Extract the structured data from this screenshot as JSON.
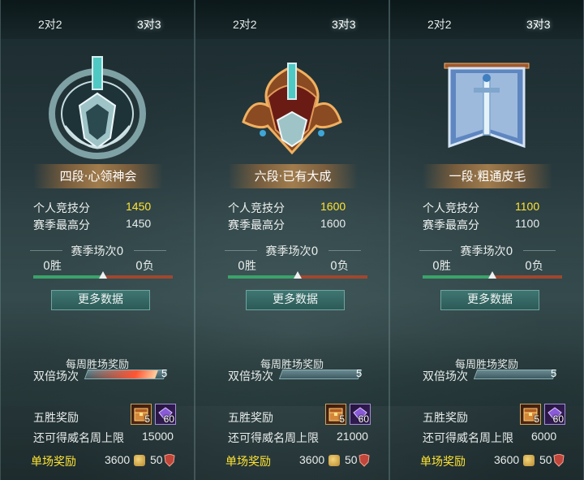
{
  "panels": [
    {
      "tabs": [
        "2对2",
        "3对3"
      ],
      "rank_name": "四段·心领神会",
      "personal_score_label": "个人竞技分",
      "personal_score": "1450",
      "season_high_label": "赛季最高分",
      "season_high": "1450",
      "season_matches_label": "赛季场次0",
      "wins": "0胜",
      "losses": "0负",
      "more_data_label": "更多数据",
      "weekly_title": "每周胜场奖励",
      "double_label": "双倍场次",
      "double_progress": "5",
      "five_win_label": "五胜奖励",
      "chest_count": "5",
      "gem_count": "60",
      "cap_label": "还可得威名周上限",
      "cap_value": "15000",
      "single_label": "单场奖励",
      "single_coin": "3600",
      "single_shield": "50",
      "emblem": "silver-shield-emblem",
      "progress_fill": 0.9
    },
    {
      "tabs": [
        "2对2",
        "3对3"
      ],
      "rank_name": "六段·已有大成",
      "personal_score_label": "个人竞技分",
      "personal_score": "1600",
      "season_high_label": "赛季最高分",
      "season_high": "1600",
      "season_matches_label": "赛季场次0",
      "wins": "0胜",
      "losses": "0负",
      "more_data_label": "更多数据",
      "weekly_title": "每周胜场奖励",
      "double_label": "双倍场次",
      "double_progress": "5",
      "five_win_label": "五胜奖励",
      "chest_count": "5",
      "gem_count": "60",
      "cap_label": "还可得威名周上限",
      "cap_value": "21000",
      "single_label": "单场奖励",
      "single_coin": "3600",
      "single_shield": "50",
      "emblem": "bronze-winged-emblem",
      "progress_fill": 0
    },
    {
      "tabs": [
        "2对2",
        "3对3"
      ],
      "rank_name": "一段·粗通皮毛",
      "personal_score_label": "个人竞技分",
      "personal_score": "1100",
      "season_high_label": "赛季最高分",
      "season_high": "1100",
      "season_matches_label": "赛季场次0",
      "wins": "0胜",
      "losses": "0负",
      "more_data_label": "更多数据",
      "weekly_title": "每周胜场奖励",
      "double_label": "双倍场次",
      "double_progress": "5",
      "five_win_label": "五胜奖励",
      "chest_count": "5",
      "gem_count": "60",
      "cap_label": "还可得威名周上限",
      "cap_value": "6000",
      "single_label": "单场奖励",
      "single_coin": "3600",
      "single_shield": "50",
      "emblem": "blue-banner-sword-emblem",
      "progress_fill": 0
    }
  ],
  "colors": {
    "highlight_score": "#ffe433",
    "single_reward_label": "#ffe433",
    "win_bar": "#3aa36a",
    "loss_bar": "#a0472e",
    "button": "#3f7672"
  }
}
